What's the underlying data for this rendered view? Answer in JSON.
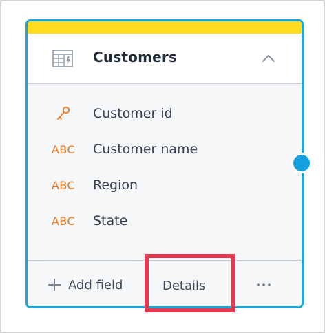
{
  "dataset": {
    "title": "Customers",
    "accent_color": "#fddb1d",
    "border_color": "#1aa6dc",
    "icon": "table-icon",
    "collapse_icon": "chevron-up-icon"
  },
  "fields": [
    {
      "type": "key",
      "icon": "key-icon",
      "type_label": "",
      "label": "Customer id"
    },
    {
      "type": "attribute",
      "icon": "abc-icon",
      "type_label": "ABC",
      "label": "Customer name"
    },
    {
      "type": "attribute",
      "icon": "abc-icon",
      "type_label": "ABC",
      "label": "Region"
    },
    {
      "type": "attribute",
      "icon": "abc-icon",
      "type_label": "ABC",
      "label": "State"
    }
  ],
  "footer": {
    "add_field_label": "Add field",
    "details_label": "Details",
    "more_icon": "more-options-icon"
  },
  "annotation": {
    "highlight_color": "#e33a52",
    "connector_color": "#14a0dd"
  }
}
